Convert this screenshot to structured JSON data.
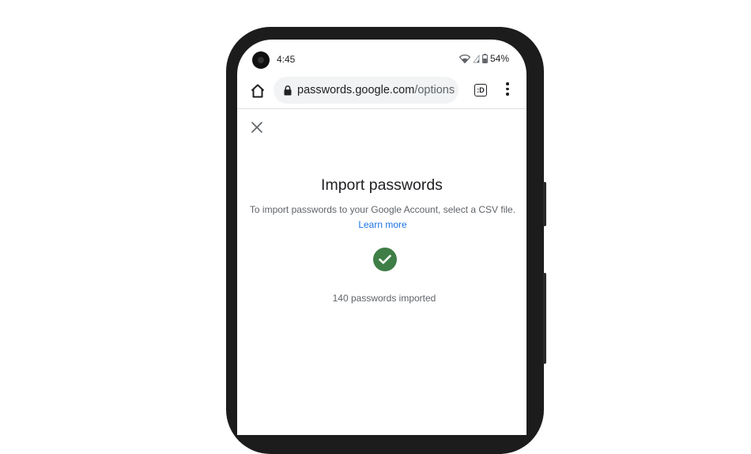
{
  "status_bar": {
    "time": "4:45",
    "battery": "54%",
    "icons": [
      "wifi-icon",
      "signal-icon",
      "battery-icon"
    ]
  },
  "browser": {
    "url_host": "passwords.google.com",
    "url_path": "/options",
    "tabs_count": ":D",
    "icons": [
      "home-icon",
      "lock-icon",
      "tabs-icon",
      "more-vert-icon"
    ]
  },
  "dialog": {
    "close_icon": "close-icon",
    "title": "Import passwords",
    "description": "To import passwords to your Google Account, select a CSV file.",
    "learn_more": "Learn more",
    "success_icon": "check-circle-icon",
    "result": "140 passwords imported"
  },
  "colors": {
    "success": "#3f7e46",
    "link": "#1a73e8",
    "url_bar_bg": "#f1f3f4"
  }
}
